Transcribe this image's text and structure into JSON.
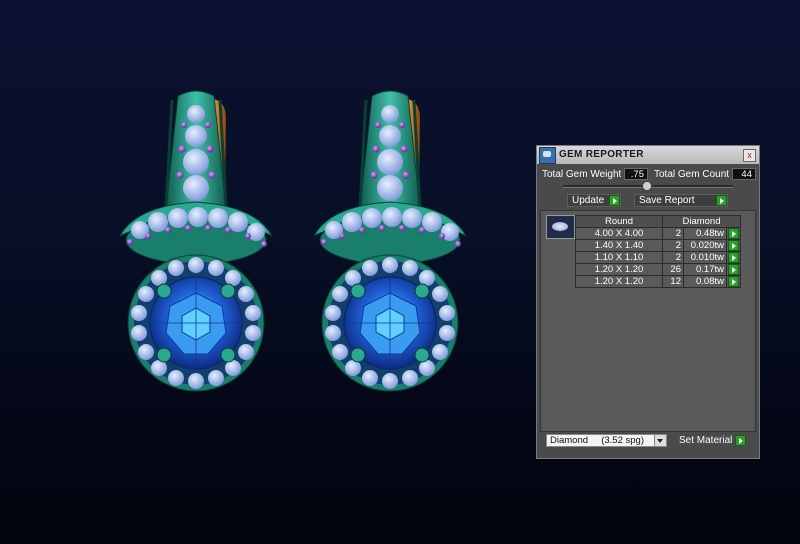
{
  "panel": {
    "title": "GEM REPORTER",
    "close_glyph": "x",
    "total_weight_label": "Total Gem Weight",
    "total_weight_value": ".75",
    "total_count_label": "Total Gem Count",
    "total_count_value": "44",
    "update_label": "Update",
    "save_report_label": "Save Report",
    "table": {
      "shape_header": "Round",
      "material_header": "Diamond",
      "rows": [
        {
          "size": "4.00 X 4.00",
          "count": "2",
          "weight": "0.48tw"
        },
        {
          "size": "1.40 X 1.40",
          "count": "2",
          "weight": "0.020tw"
        },
        {
          "size": "1.10 X 1.10",
          "count": "2",
          "weight": "0.010tw"
        },
        {
          "size": "1.20 X 1.20",
          "count": "26",
          "weight": "0.17tw"
        },
        {
          "size": "1.20 X 1.20",
          "count": "12",
          "weight": "0.08tw"
        }
      ]
    },
    "material_select_value": "Diamond     (3.52 spg)",
    "set_material_label": "Set Material"
  },
  "colors": {
    "metal": "#1f8c78",
    "metal_light": "#3fc0a8",
    "center_stone": "#1e5fd6",
    "halo_stone": "#9fb7ea",
    "accent_stone": "#8a3ad0",
    "back_gold": "#c46a14",
    "panel_bg": "#4a4a4a",
    "go_button": "#2aa02a"
  }
}
